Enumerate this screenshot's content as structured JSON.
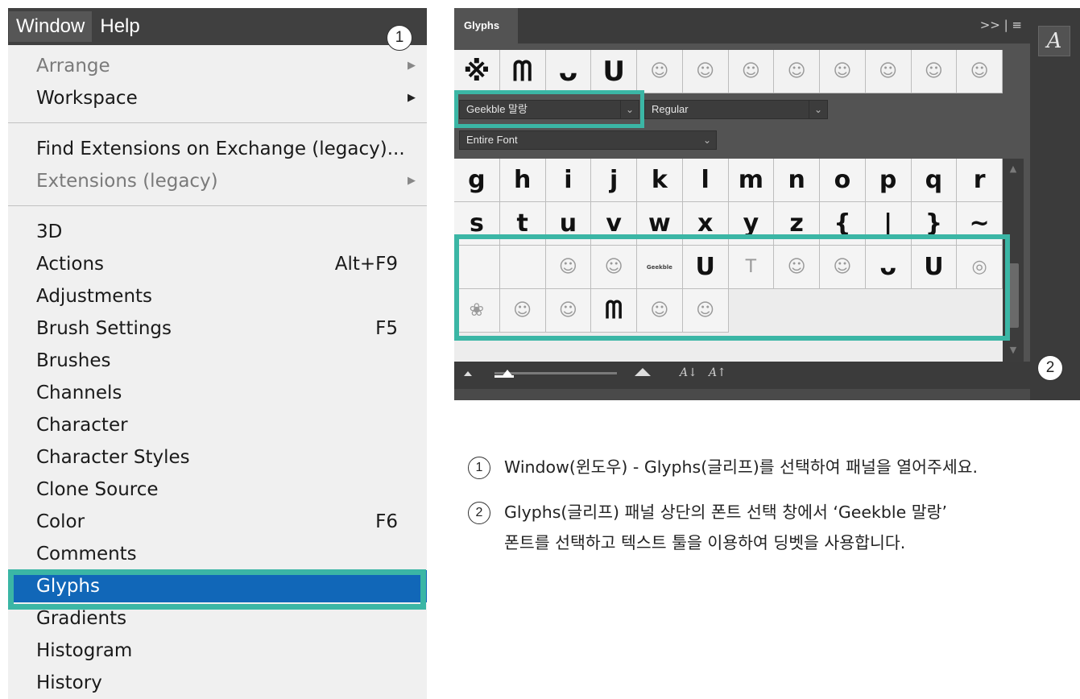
{
  "menubar": {
    "items": [
      "Window",
      "Help"
    ]
  },
  "menu": {
    "group1": [
      {
        "label": "Arrange",
        "disabled": true,
        "submenu": true
      },
      {
        "label": "Workspace",
        "disabled": false,
        "submenu": true
      }
    ],
    "group2": [
      {
        "label": "Find Extensions on Exchange (legacy)...",
        "disabled": false
      },
      {
        "label": "Extensions (legacy)",
        "disabled": true,
        "submenu": true
      }
    ],
    "group3": [
      {
        "label": "3D",
        "shortcut": ""
      },
      {
        "label": "Actions",
        "shortcut": "Alt+F9"
      },
      {
        "label": "Adjustments",
        "shortcut": ""
      },
      {
        "label": "Brush Settings",
        "shortcut": "F5"
      },
      {
        "label": "Brushes",
        "shortcut": ""
      },
      {
        "label": "Channels",
        "shortcut": ""
      },
      {
        "label": "Character",
        "shortcut": ""
      },
      {
        "label": "Character Styles",
        "shortcut": ""
      },
      {
        "label": "Clone Source",
        "shortcut": ""
      },
      {
        "label": "Color",
        "shortcut": "F6"
      },
      {
        "label": "Comments",
        "shortcut": ""
      },
      {
        "label": "Glyphs",
        "shortcut": "",
        "selected": true
      },
      {
        "label": "Gradients",
        "shortcut": ""
      },
      {
        "label": "Histogram",
        "shortcut": ""
      },
      {
        "label": "History",
        "shortcut": ""
      }
    ]
  },
  "markers": {
    "one": "1",
    "two": "2"
  },
  "panel": {
    "tab_label": "Glyphs",
    "tab_controls": ">> | ≡",
    "recent_glyphs": [
      "※",
      "ᗰ",
      "ᴗ",
      "U",
      "☺",
      "☺",
      "☺",
      "☺",
      "☺",
      "☺",
      "☺",
      "☺"
    ],
    "font_family": "Geekble 말랑",
    "font_style": "Regular",
    "scope": "Entire Font",
    "grid_rows": [
      [
        "g",
        "h",
        "i",
        "j",
        "k",
        "l",
        "m",
        "n",
        "o",
        "p",
        "q",
        "r"
      ],
      [
        "s",
        "t",
        "u",
        "v",
        "w",
        "x",
        "y",
        "z",
        "{",
        "|",
        "}",
        "~"
      ],
      [
        "",
        "",
        "☺",
        "☺",
        "Geekble",
        "U",
        "T",
        "☺",
        "☺",
        "ᴗ",
        "U",
        "◎"
      ],
      [
        "❀",
        "☺",
        "☺",
        "ᗰ",
        "☺",
        "☺"
      ]
    ],
    "bottom_icons": [
      "A↓",
      "A↑"
    ],
    "character_button": "A"
  },
  "instructions": [
    {
      "num": "1",
      "text": "Window(윈도우) - Glyphs(글리프)를 선택하여 패널을 열어주세요."
    },
    {
      "num": "2",
      "line1": "Glyphs(글리프) 패널 상단의 폰트 선택 창에서 ‘Geekble 말랑’",
      "line2": "폰트를 선택하고 텍스트 툴을 이용하여 딩벳을 사용합니다."
    }
  ]
}
